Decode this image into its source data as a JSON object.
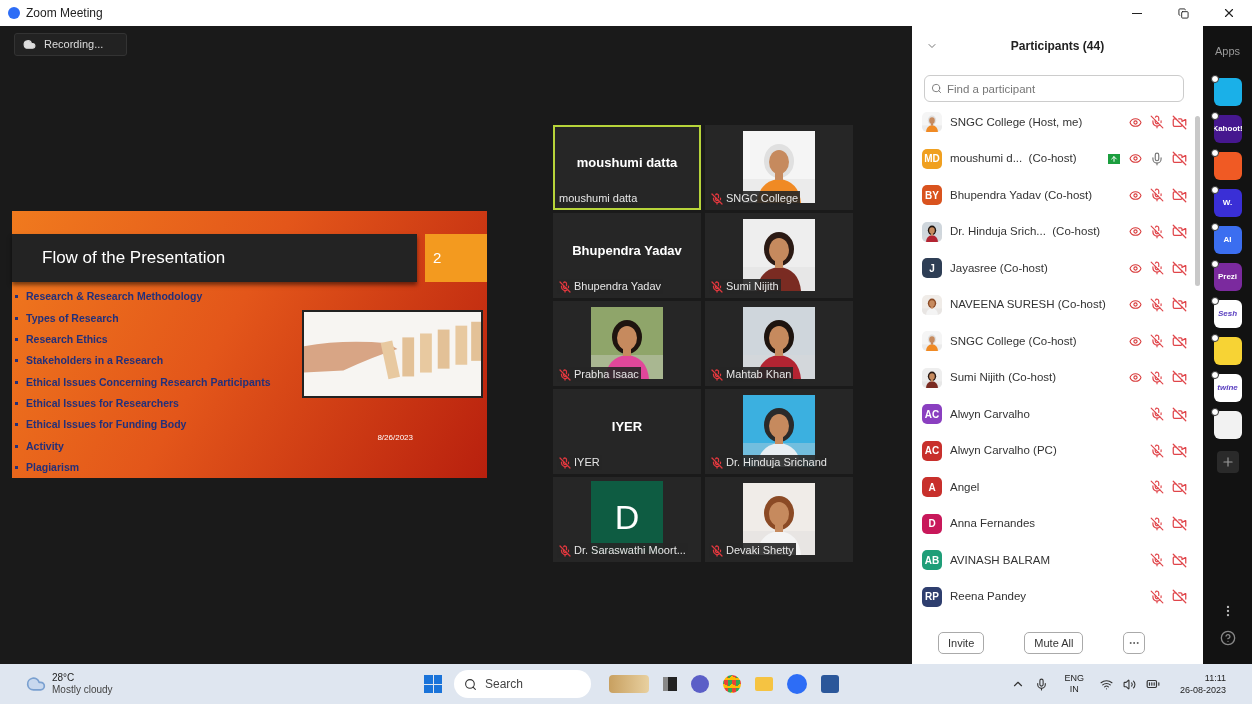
{
  "window": {
    "title": "Zoom Meeting"
  },
  "recording": {
    "label": "Recording..."
  },
  "slide": {
    "title": "Flow of the Presentation",
    "number": "2",
    "date": "8/26/2023",
    "bullets": [
      "Research & Research Methodology",
      "Types of Research",
      "Research Ethics",
      "Stakeholders in a Research",
      "Ethical Issues Concerning Research Participants",
      "Ethical Issues for Researchers",
      "Ethical Issues for Funding Body",
      "Activity",
      "Plagiarism"
    ]
  },
  "video_tiles": [
    {
      "kind": "name",
      "display": "moushumi datta",
      "label": "moushumi datta",
      "muted": false,
      "selected": true
    },
    {
      "kind": "picture",
      "label": "SNGC College",
      "muted": true,
      "selected": false
    },
    {
      "kind": "name",
      "display": "Bhupendra Yadav",
      "label": "Bhupendra Yadav",
      "muted": true,
      "selected": false
    },
    {
      "kind": "picture",
      "label": "Sumi Nijith",
      "muted": true,
      "selected": false
    },
    {
      "kind": "picture",
      "label": "Prabha Isaac",
      "muted": true,
      "selected": false
    },
    {
      "kind": "picture",
      "label": "Mahtab Khan",
      "muted": true,
      "selected": false
    },
    {
      "kind": "name",
      "display": "IYER",
      "label": "IYER",
      "muted": true,
      "selected": false
    },
    {
      "kind": "picture",
      "label": "Dr. Hinduja Srichand",
      "muted": true,
      "selected": false
    },
    {
      "kind": "initial",
      "display": "D",
      "label": "Dr. Saraswathi Moort...",
      "muted": true,
      "selected": false
    },
    {
      "kind": "picture",
      "label": "Devaki Shetty",
      "muted": true,
      "selected": false
    }
  ],
  "participants": {
    "title": "Participants (44)",
    "search": {
      "placeholder": "Find a participant"
    },
    "rows": [
      {
        "name": "SNGC College (Host, me)",
        "sharing": false,
        "spotlight": true,
        "muted": true,
        "video_off": true
      },
      {
        "name": "moushumi d...  (Co-host)",
        "avatar": {
          "kind": "initials",
          "text": "MD",
          "color": "#f0a020"
        },
        "sharing": true,
        "spotlight": true,
        "muted": false,
        "video_off": true
      },
      {
        "name": "Bhupendra Yadav (Co-host)",
        "avatar": {
          "kind": "initials",
          "text": "BY",
          "color": "#d9531e"
        },
        "sharing": false,
        "spotlight": true,
        "muted": true,
        "video_off": true
      },
      {
        "name": "Dr. Hinduja Srich...  (Co-host)",
        "sharing": false,
        "spotlight": true,
        "muted": true,
        "video_off": true
      },
      {
        "name": "Jayasree (Co-host)",
        "avatar": {
          "kind": "initials",
          "text": "J",
          "color": "#2e3e55"
        },
        "sharing": false,
        "spotlight": true,
        "muted": true,
        "video_off": true
      },
      {
        "name": "NAVEENA SURESH (Co-host)",
        "sharing": false,
        "spotlight": true,
        "muted": true,
        "video_off": true
      },
      {
        "name": "SNGC College (Co-host)",
        "sharing": false,
        "spotlight": true,
        "muted": true,
        "video_off": true
      },
      {
        "name": "Sumi Nijith (Co-host)",
        "sharing": false,
        "spotlight": true,
        "muted": true,
        "video_off": true
      },
      {
        "name": "Alwyn Carvalho",
        "avatar": {
          "kind": "initials",
          "text": "AC",
          "color": "#8a3fc0"
        },
        "sharing": false,
        "spotlight": false,
        "muted": true,
        "video_off": true
      },
      {
        "name": "Alwyn Carvalho (PC)",
        "avatar": {
          "kind": "initials",
          "text": "AC",
          "color": "#c8302c"
        },
        "sharing": false,
        "spotlight": false,
        "muted": true,
        "video_off": true
      },
      {
        "name": "Angel",
        "avatar": {
          "kind": "initials",
          "text": "A",
          "color": "#c8302c"
        },
        "sharing": false,
        "spotlight": false,
        "muted": true,
        "video_off": true
      },
      {
        "name": "Anna Fernandes",
        "avatar": {
          "kind": "initials",
          "text": "D",
          "color": "#c8185a"
        },
        "sharing": false,
        "spotlight": false,
        "muted": true,
        "video_off": true
      },
      {
        "name": "AVINASH BALRAM",
        "avatar": {
          "kind": "initials",
          "text": "AB",
          "color": "#1f9e78"
        },
        "sharing": false,
        "spotlight": false,
        "muted": true,
        "video_off": true
      },
      {
        "name": "Reena Pandey",
        "avatar": {
          "kind": "initials",
          "text": "RP",
          "color": "#2e3e6e"
        },
        "sharing": false,
        "spotlight": false,
        "muted": true,
        "video_off": true
      }
    ],
    "buttons": [
      "Invite",
      "Mute All"
    ]
  },
  "apps": {
    "title": "Apps",
    "items": [
      {
        "color": "#1ab0e8"
      },
      {
        "color": "#46178f",
        "label": "Kahoot!"
      },
      {
        "color": "#f05a24"
      },
      {
        "color": "#3a2fd6",
        "label": "W."
      },
      {
        "color": "#3b6ef0",
        "label": "AI"
      },
      {
        "color": "#7b2a9e",
        "label": "Prezi"
      },
      {
        "color": "#ffffff",
        "label": "Sesh"
      },
      {
        "color": "#f7d334"
      },
      {
        "color": "#ffffff",
        "label": "twine"
      },
      {
        "color": "#f2f2f2"
      }
    ]
  },
  "taskbar": {
    "temperature": "28°C",
    "weather": "Mostly cloudy",
    "search": "Search",
    "language": "ENG",
    "region": "IN",
    "time": "11:11",
    "date": "26-08-2023"
  }
}
